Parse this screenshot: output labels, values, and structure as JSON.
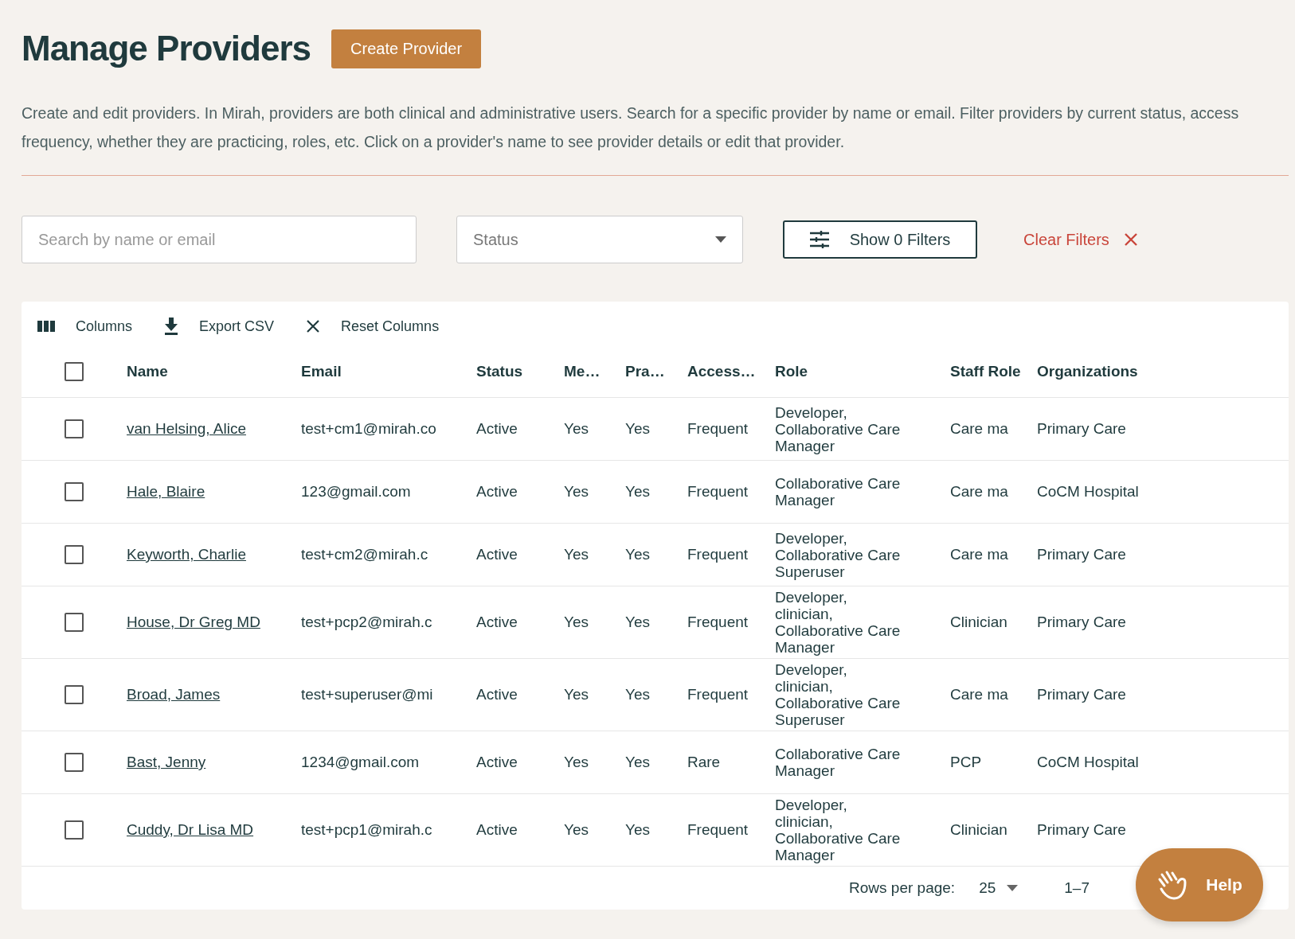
{
  "page": {
    "title": "Manage Providers",
    "create_button": "Create Provider"
  },
  "description": "Create and edit providers. In Mirah, providers are both clinical and administrative users. Search for a specific provider by name or email. Filter providers by current status, access frequency, whether they are practicing, roles, etc. Click on a provider's name to see provider details or edit that provider.",
  "filters": {
    "search": {
      "placeholder": "Search by name or email"
    },
    "status": {
      "placeholder": "Status"
    },
    "show_filters": "Show 0 Filters",
    "clear_filters": "Clear Filters"
  },
  "toolbar": [
    {
      "kind": "columns",
      "label": "Columns"
    },
    {
      "kind": "export",
      "label": "Export CSV"
    },
    {
      "kind": "reset",
      "label": "Reset Columns"
    }
  ],
  "table": {
    "select_all": {
      "checked": false
    },
    "columns": [
      "Name",
      "Email",
      "Status",
      "Me…",
      "Pra…",
      "Access…",
      "Role",
      "Staff Role",
      "Organizations"
    ],
    "rows": [
      {
        "checked": false,
        "name": "van Helsing, Alice",
        "email": "test+cm1@mirah.co",
        "status": "Active",
        "column_4": "Yes",
        "column_5": "Yes",
        "access": "Frequent",
        "role": "Developer, Collaborative Care Manager",
        "staff_role": "Care ma",
        "organization": "Primary Care"
      },
      {
        "checked": false,
        "name": "Hale, Blaire",
        "email": "123@gmail.com",
        "status": "Active",
        "column_4": "Yes",
        "column_5": "Yes",
        "access": "Frequent",
        "role": "Collaborative Care Manager",
        "staff_role": "Care ma",
        "organization": "CoCM Hospital"
      },
      {
        "checked": false,
        "name": "Keyworth, Charlie",
        "email": "test+cm2@mirah.c",
        "status": "Active",
        "column_4": "Yes",
        "column_5": "Yes",
        "access": "Frequent",
        "role": "Developer, Collaborative Care Superuser",
        "staff_role": "Care ma",
        "organization": "Primary Care"
      },
      {
        "checked": false,
        "name": "House, Dr Greg MD",
        "email": "test+pcp2@mirah.c",
        "status": "Active",
        "column_4": "Yes",
        "column_5": "Yes",
        "access": "Frequent",
        "role": "Developer, clinician, Collaborative Care Manager",
        "staff_role": "Clinician",
        "organization": "Primary Care"
      },
      {
        "checked": false,
        "name": "Broad, James",
        "email": "test+superuser@mi",
        "status": "Active",
        "column_4": "Yes",
        "column_5": "Yes",
        "access": "Frequent",
        "role": "Developer, clinician, Collaborative Care Superuser",
        "staff_role": "Care ma",
        "organization": "Primary Care"
      },
      {
        "checked": false,
        "name": "Bast, Jenny",
        "email": "1234@gmail.com",
        "status": "Active",
        "column_4": "Yes",
        "column_5": "Yes",
        "access": "Rare",
        "role": "Collaborative Care Manager",
        "staff_role": "PCP",
        "organization": "CoCM Hospital"
      },
      {
        "checked": false,
        "name": "Cuddy, Dr Lisa MD",
        "email": "test+pcp1@mirah.c",
        "status": "Active",
        "column_4": "Yes",
        "column_5": "Yes",
        "access": "Frequent",
        "role": "Developer, clinician, Collaborative Care Manager",
        "staff_role": "Clinician",
        "organization": "Primary Care"
      }
    ]
  },
  "pagination": {
    "rows_per_page_label": "Rows per page:",
    "rows_per_page": "25",
    "range": "1–7"
  },
  "help": {
    "label": "Help"
  }
}
